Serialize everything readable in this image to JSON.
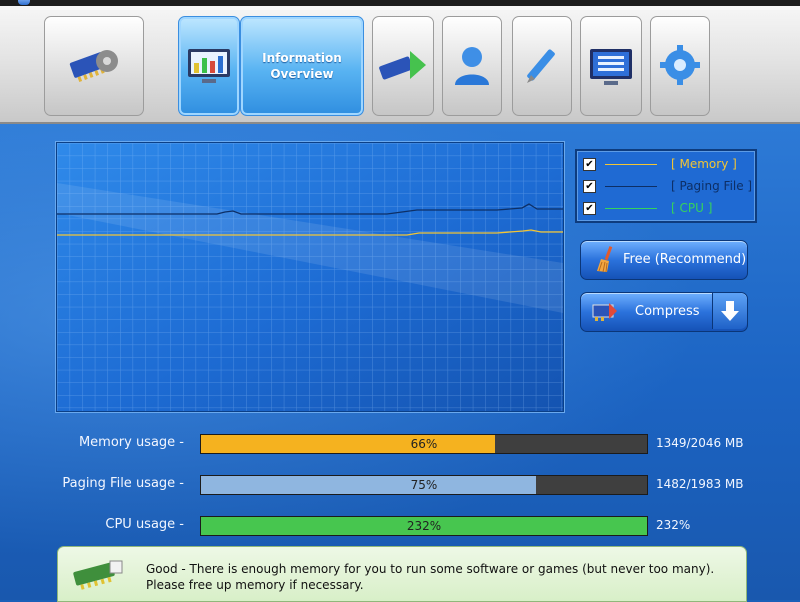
{
  "toolbar": {
    "active_title": "Information\nOverview",
    "icons": [
      "memory-chip-gear-icon",
      "chart-monitor-icon",
      "memory-chip-arrow-icon",
      "user-icon",
      "pen-icon",
      "monitor-list-icon",
      "gear-refresh-icon"
    ]
  },
  "legend": {
    "items": [
      {
        "label": "[ Memory ]",
        "color": "#f3c534",
        "checked": "✔"
      },
      {
        "label": "[ Paging File ]",
        "color": "#0d2f66",
        "checked": "✔"
      },
      {
        "label": "[ CPU ]",
        "color": "#35d35c",
        "checked": "✔"
      }
    ]
  },
  "buttons": {
    "free": "Free (Recommend)",
    "compress": "Compress"
  },
  "usage": [
    {
      "label": "Memory usage -",
      "percent_text": "66%",
      "fraction": 0.66,
      "value": "1349/2046 MB",
      "color": "#f5b21f"
    },
    {
      "label": "Paging File usage -",
      "percent_text": "75%",
      "fraction": 0.75,
      "value": "1482/1983 MB",
      "color": "#8fb6e0"
    },
    {
      "label": "CPU usage -",
      "percent_text": "232%",
      "fraction": 1.0,
      "value": "232%",
      "color": "#47c64f"
    }
  ],
  "status": {
    "text": "Good - There is enough memory for you to run some software or games (but never too many). Please free up memory if necessary."
  }
}
